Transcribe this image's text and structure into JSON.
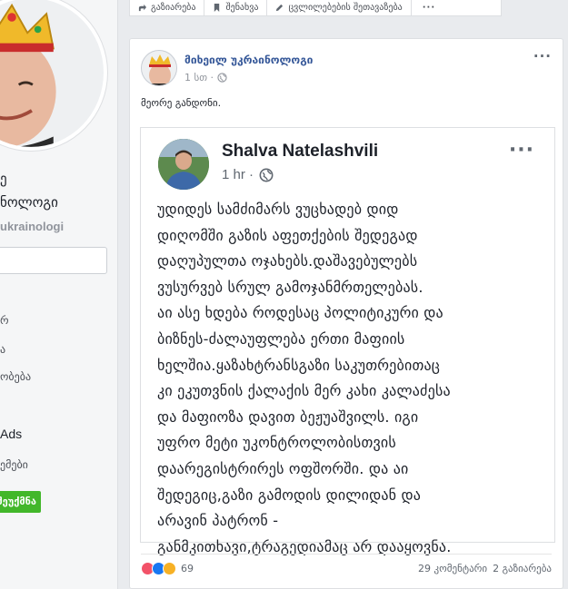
{
  "sidebar": {
    "name_line1": "ე",
    "name_line2": "ნოლოგი",
    "handle": "ukrainologi",
    "items": [
      "რ",
      "ა",
      "ობება"
    ],
    "ads": "Ads",
    "bottom_item": "ემები",
    "button_label": "შეუქმნა"
  },
  "topbar": {
    "share": "გაზიარება",
    "save": "შენახვა",
    "suggest_edits": "ცვლილებების შეთავაზება",
    "more": "···"
  },
  "post": {
    "author": "მიხეილ უკრაინოლოგი",
    "time": "1 სთ ·",
    "more": "···",
    "caption": "მეორე განდონი."
  },
  "shared_post": {
    "author": "Shalva Natelashvili",
    "time": "1 hr ·",
    "more": "···",
    "lines": [
      "უდიდეს სამძიმარს ვუცხადებ დიდ",
      "დიღომში გაზის აფეთქების შედეგად",
      "დაღუპულთა ოჯახებს.დაშავებულებს",
      "ვუსურვებ სრულ გამოჯანმრთელებას.",
      "აი ასე ხდება როდესაც პოლიტიკური და",
      "ბიზნეს-ძალაუფლება ერთი მაფიის",
      "ხელშია.ყაზახტრანსგაზი საკუთრებითაც",
      "კი ეკუთვნის ქალაქის მერ კახი კალაძესა",
      "და მაფიოზა დავით ბეჟუაშვილს. იგი",
      "უფრო  მეტი უკონტროლობისთვის",
      "დაარეგისტრირეს ოფშორში. და აი",
      "შედეგიც,გაზი გამოდის დილიდან და",
      "არავინ პატრონ -",
      "განმკითხავი,ტრაგედიამაც არ დააყოვნა."
    ]
  },
  "footer": {
    "reaction_count": "69",
    "comments": "29 კომენტარი",
    "shares": "2 გაზიარება",
    "reaction_colors": [
      "#f25268",
      "#1877f2",
      "#f7b125"
    ]
  }
}
